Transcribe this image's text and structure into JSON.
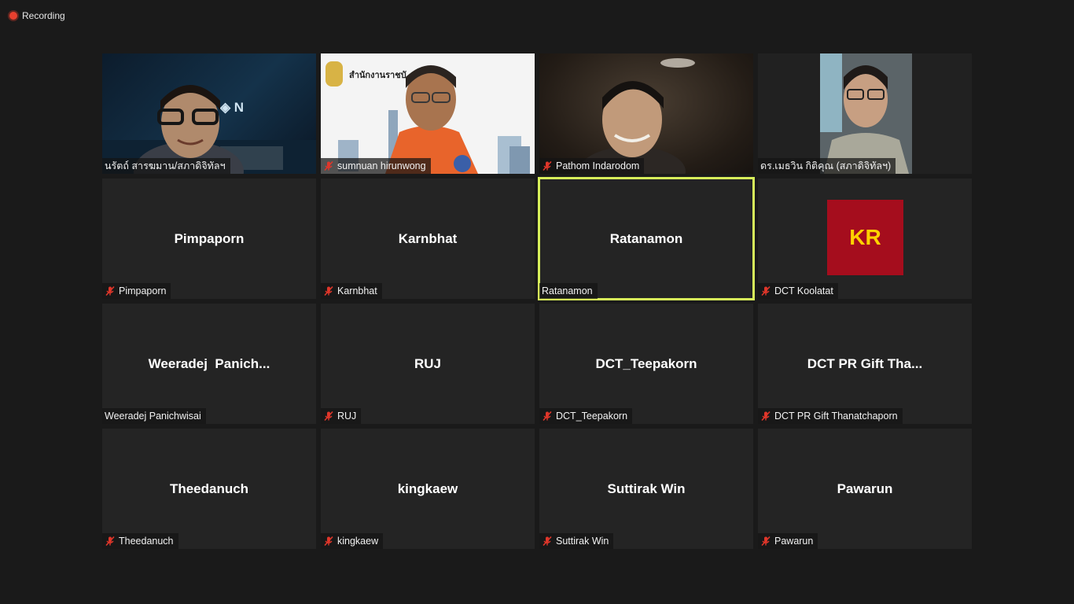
{
  "recording": {
    "label": "Recording"
  },
  "colors": {
    "speaking_border": "#d7ef5a",
    "mute_icon": "#e0362a",
    "avatar_kr_bg": "#a50d1d",
    "avatar_kr_text": "#ffd200"
  },
  "tiles": [
    {
      "name": "นรัตถ์ สารฆมาน/สภาดิจิทัลฯ",
      "video": true,
      "muted": false
    },
    {
      "name": "sumnuan hirunwong",
      "video": true,
      "muted": true,
      "banner_text": "สำนักงานราชบั"
    },
    {
      "name": "Pathom Indarodom",
      "video": true,
      "muted": true
    },
    {
      "name": "ดร.เมธวิน กิติคุณ (สภาดิจิทัลฯ)",
      "video": true,
      "muted": false
    },
    {
      "name": "Pimpaporn",
      "display": "Pimpaporn",
      "muted": true
    },
    {
      "name": "Karnbhat",
      "display": "Karnbhat",
      "muted": true
    },
    {
      "name": "Ratanamon",
      "display": "Ratanamon",
      "muted": false,
      "speaking": true
    },
    {
      "name": "DCT Koolatat",
      "avatar": "KR",
      "muted": true
    },
    {
      "name": "Weeradej Panichwisai",
      "display": "Weeradej  Panich...",
      "muted": false
    },
    {
      "name": "RUJ",
      "display": "RUJ",
      "muted": true
    },
    {
      "name": "DCT_Teepakorn",
      "display": "DCT_Teepakorn",
      "muted": true
    },
    {
      "name": "DCT PR Gift Thanatchaporn",
      "display": "DCT PR Gift Tha...",
      "muted": true
    },
    {
      "name": "Theedanuch",
      "display": "Theedanuch",
      "muted": true
    },
    {
      "name": "kingkaew",
      "display": "kingkaew",
      "muted": true
    },
    {
      "name": "Suttirak Win",
      "display": "Suttirak Win",
      "muted": true
    },
    {
      "name": "Pawarun",
      "display": "Pawarun",
      "muted": true
    }
  ]
}
